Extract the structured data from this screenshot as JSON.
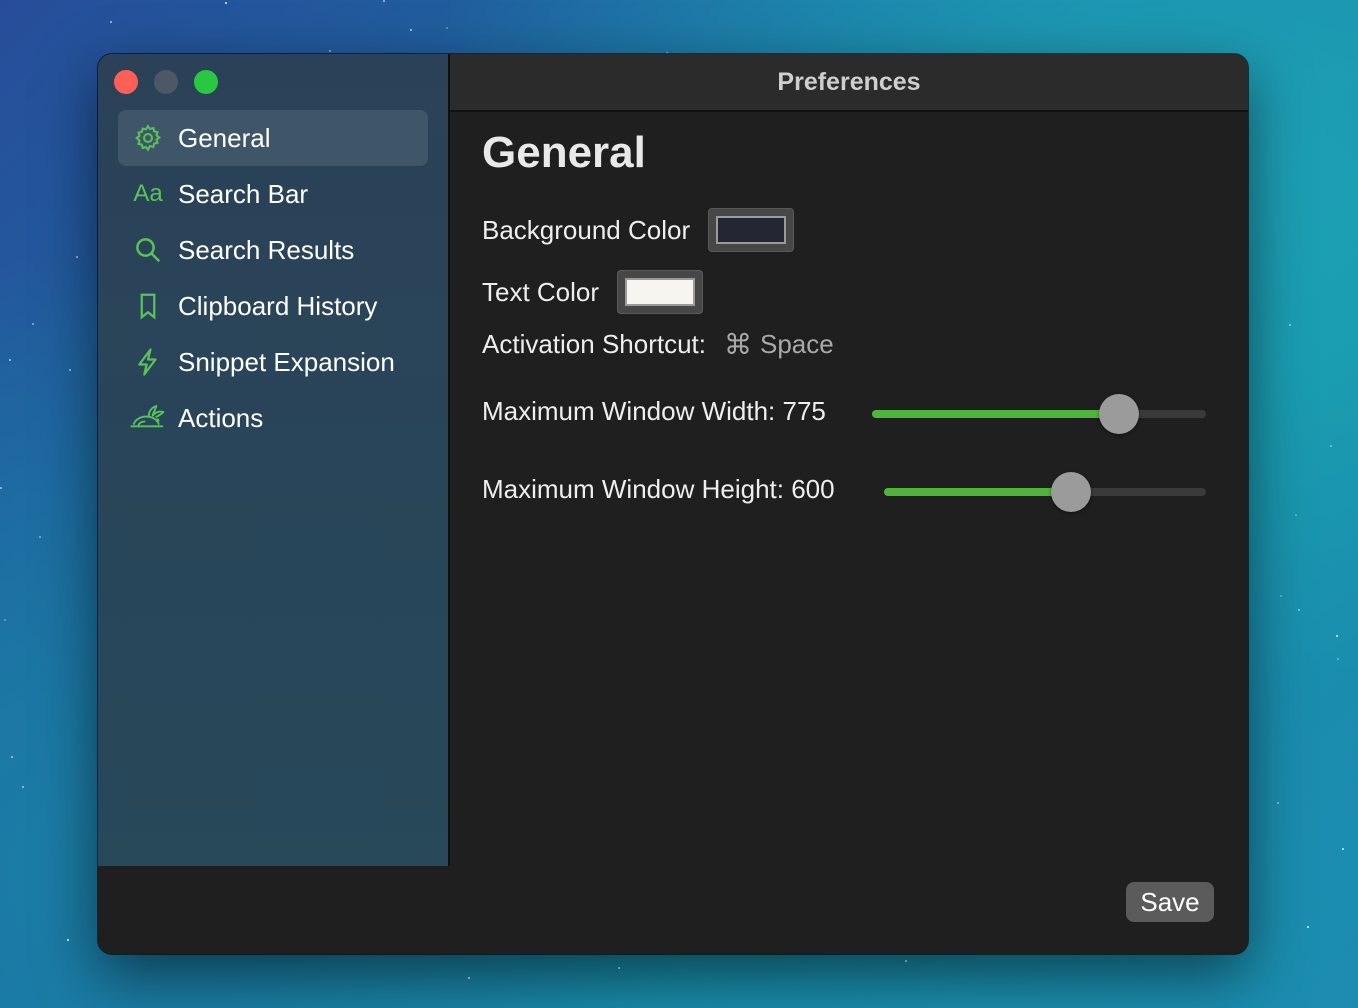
{
  "window": {
    "title": "Preferences"
  },
  "sidebar": {
    "items": [
      {
        "label": "General",
        "icon": "gear-icon",
        "active": true
      },
      {
        "label": "Search Bar",
        "icon": "text-aa-icon",
        "icon_text": "Aa"
      },
      {
        "label": "Search Results",
        "icon": "search-icon"
      },
      {
        "label": "Clipboard History",
        "icon": "bookmark-icon"
      },
      {
        "label": "Snippet Expansion",
        "icon": "lightning-icon"
      },
      {
        "label": "Actions",
        "icon": "rabbit-icon"
      }
    ]
  },
  "main": {
    "heading": "General",
    "background_color": {
      "label": "Background Color",
      "value": "#242733"
    },
    "text_color": {
      "label": "Text Color",
      "value": "#f7f5ef"
    },
    "shortcut": {
      "label": "Activation Shortcut:",
      "key_symbol": "⌘",
      "key": "Space"
    },
    "width_slider": {
      "label": "Maximum Window Width: 775",
      "fraction": 0.74
    },
    "height_slider": {
      "label": "Maximum Window Height: 600",
      "fraction": 0.58
    }
  },
  "footer": {
    "save_label": "Save"
  },
  "colors": {
    "accent": "#59c35a",
    "slider_fill": "#4fb53a"
  }
}
